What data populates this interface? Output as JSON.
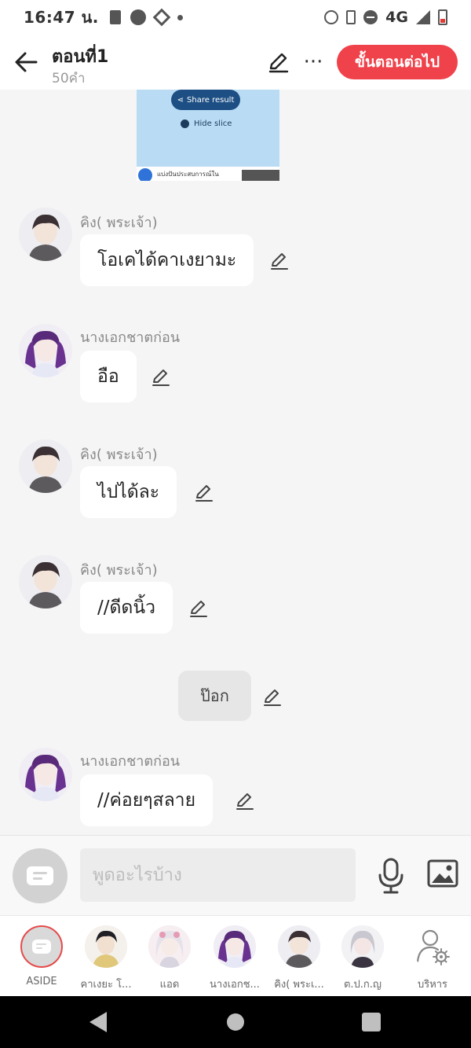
{
  "status_bar": {
    "time": "16:47 น.",
    "network": "4G"
  },
  "header": {
    "title": "ตอนที่1",
    "word_count": "50คำ",
    "next_button": "ขั้นตอนต่อไป",
    "more_label": "···"
  },
  "embedded_image": {
    "share_label": "Share result",
    "hide_slice_label": "Hide slice",
    "footer_text": "แบ่งปันประสบการณ์ใน"
  },
  "messages": [
    {
      "sender": "คิง( พระเจ้า)",
      "text": "โอเคได้คาเงยามะ"
    },
    {
      "sender": "นางเอกชาตก่อน",
      "text": "อือ"
    },
    {
      "sender": "คิง( พระเจ้า)",
      "text": "ไปได้ละ"
    },
    {
      "sender": "คิง( พระเจ้า)",
      "text": "//ดีดนิ้ว"
    },
    {
      "sender": "นางเอกชาตก่อน",
      "text": "//ค่อยๆสลาย"
    }
  ],
  "narration": {
    "text": "ป๊อก"
  },
  "input": {
    "placeholder": "พูดอะไรบ้าง",
    "value": ""
  },
  "characters": [
    {
      "label": "ASIDE"
    },
    {
      "label": "คาเงยะ โ..."
    },
    {
      "label": "แอด"
    },
    {
      "label": "นางเอกช..."
    },
    {
      "label": "คิง( พระเ..."
    },
    {
      "label": "ต.ป.ก.ญ"
    },
    {
      "label": "บริหาร"
    }
  ],
  "colors": {
    "accent": "#f0424b",
    "background": "#f5f5f5",
    "bubble": "#ffffff"
  }
}
